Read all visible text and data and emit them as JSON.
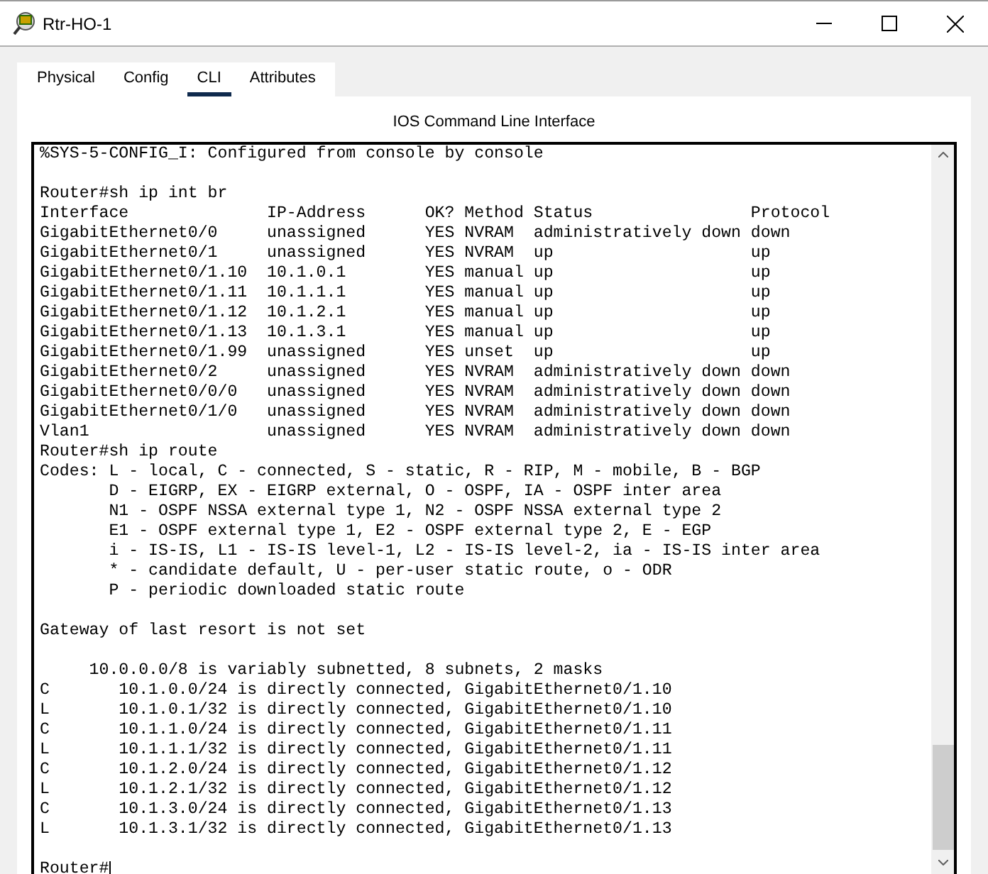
{
  "window": {
    "title": "Rtr-HO-1"
  },
  "tabs": [
    {
      "label": "Physical",
      "selected": false
    },
    {
      "label": "Config",
      "selected": false
    },
    {
      "label": "CLI",
      "selected": true
    },
    {
      "label": "Attributes",
      "selected": false
    }
  ],
  "panel_title": "IOS Command Line Interface",
  "console": {
    "blocks": [
      [
        "%SYS-5-CONFIG_I: Configured from console by console"
      ],
      [
        "Router#sh ip int br",
        "Interface              IP-Address      OK? Method Status                Protocol",
        "GigabitEthernet0/0     unassigned      YES NVRAM  administratively down down",
        "GigabitEthernet0/1     unassigned      YES NVRAM  up                    up",
        "GigabitEthernet0/1.10  10.1.0.1        YES manual up                    up",
        "GigabitEthernet0/1.11  10.1.1.1        YES manual up                    up",
        "GigabitEthernet0/1.12  10.1.2.1        YES manual up                    up",
        "GigabitEthernet0/1.13  10.1.3.1        YES manual up                    up",
        "GigabitEthernet0/1.99  unassigned      YES unset  up                    up",
        "GigabitEthernet0/2     unassigned      YES NVRAM  administratively down down",
        "GigabitEthernet0/0/0   unassigned      YES NVRAM  administratively down down",
        "GigabitEthernet0/1/0   unassigned      YES NVRAM  administratively down down",
        "Vlan1                  unassigned      YES NVRAM  administratively down down",
        "Router#sh ip route",
        "Codes: L - local, C - connected, S - static, R - RIP, M - mobile, B - BGP",
        "       D - EIGRP, EX - EIGRP external, O - OSPF, IA - OSPF inter area",
        "       N1 - OSPF NSSA external type 1, N2 - OSPF NSSA external type 2",
        "       E1 - OSPF external type 1, E2 - OSPF external type 2, E - EGP",
        "       i - IS-IS, L1 - IS-IS level-1, L2 - IS-IS level-2, ia - IS-IS inter area",
        "       * - candidate default, U - per-user static route, o - ODR",
        "       P - periodic downloaded static route"
      ],
      [
        "Gateway of last resort is not set"
      ],
      [
        "     10.0.0.0/8 is variably subnetted, 8 subnets, 2 masks",
        "C       10.1.0.0/24 is directly connected, GigabitEthernet0/1.10",
        "L       10.1.0.1/32 is directly connected, GigabitEthernet0/1.10",
        "C       10.1.1.0/24 is directly connected, GigabitEthernet0/1.11",
        "L       10.1.1.1/32 is directly connected, GigabitEthernet0/1.11",
        "C       10.1.2.0/24 is directly connected, GigabitEthernet0/1.12",
        "L       10.1.2.1/32 is directly connected, GigabitEthernet0/1.12",
        "C       10.1.3.0/24 is directly connected, GigabitEthernet0/1.13",
        "L       10.1.3.1/32 is directly connected, GigabitEthernet0/1.13"
      ],
      [
        "Router#"
      ]
    ]
  }
}
